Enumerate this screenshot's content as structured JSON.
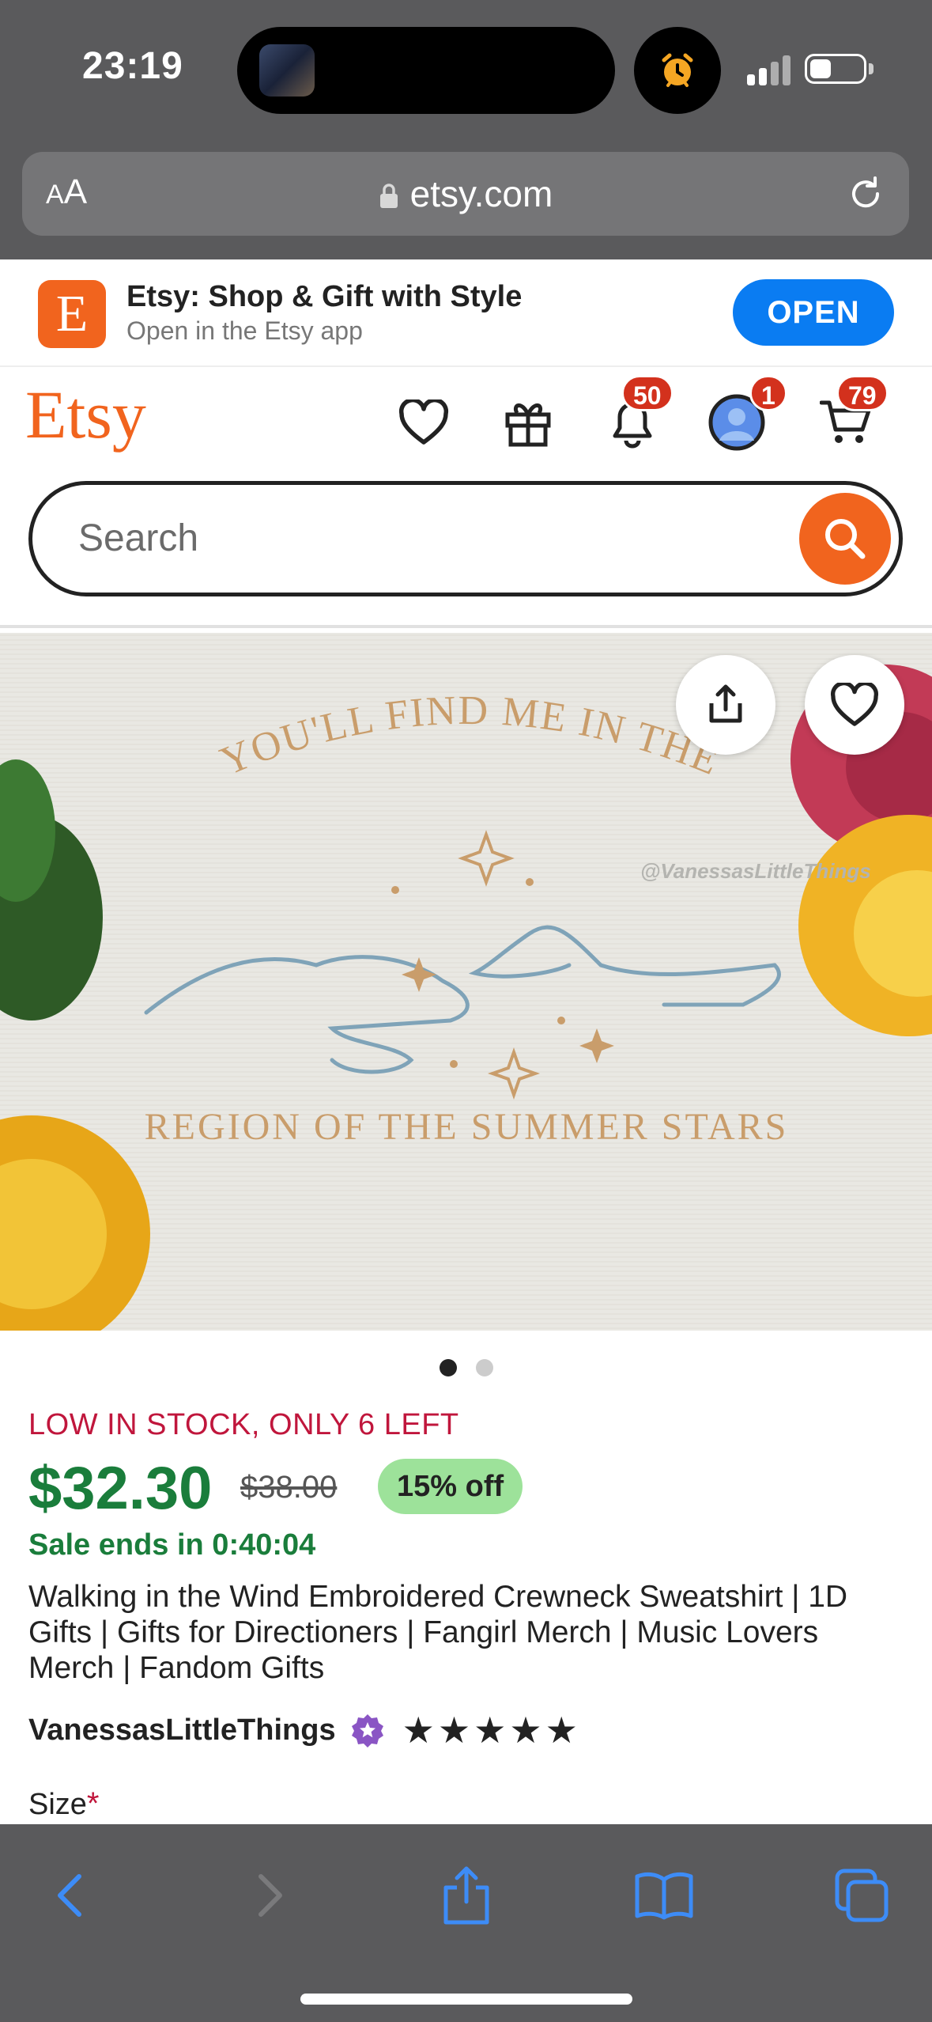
{
  "status_bar": {
    "time": "23:19",
    "alarm_icon": "alarm-clock-icon",
    "battery_percent": 40
  },
  "address_bar": {
    "aa_label_small": "A",
    "aa_label_large": "A",
    "url": "etsy.com"
  },
  "app_banner": {
    "icon_letter": "E",
    "title": "Etsy: Shop & Gift with Style",
    "subtitle": "Open in the Etsy app",
    "open_label": "OPEN"
  },
  "header": {
    "logo": "Etsy",
    "notifications_count": "50",
    "account_count": "1",
    "cart_count": "79"
  },
  "search": {
    "placeholder": "Search"
  },
  "photo": {
    "text_top": "YOU'LL FIND ME IN THE",
    "text_bottom": "REGION OF THE SUMMER STARS",
    "watermark": "@VanessasLittleThings",
    "page_count": 2,
    "current_page": 1
  },
  "product": {
    "stock": "LOW IN STOCK, ONLY 6 LEFT",
    "price": "$32.30",
    "original_price": "$38.00",
    "discount": "15% off",
    "sale_ends": "Sale ends in 0:40:04",
    "title": "Walking in the Wind Embroidered Crewneck Sweatshirt | 1D Gifts | Gifts for Directioners | Fangirl Merch | Music Lovers Merch | Fandom Gifts",
    "seller": "VanessasLittleThings",
    "rating": 5,
    "size_label": "Size",
    "required_mark": "*"
  },
  "colors": {
    "etsy_orange": "#f1641e",
    "price_green": "#1a7d3b",
    "stock_red": "#c0163c",
    "ios_blue": "#0a7cf2",
    "toolbar_blue": "#3d8cf7"
  }
}
